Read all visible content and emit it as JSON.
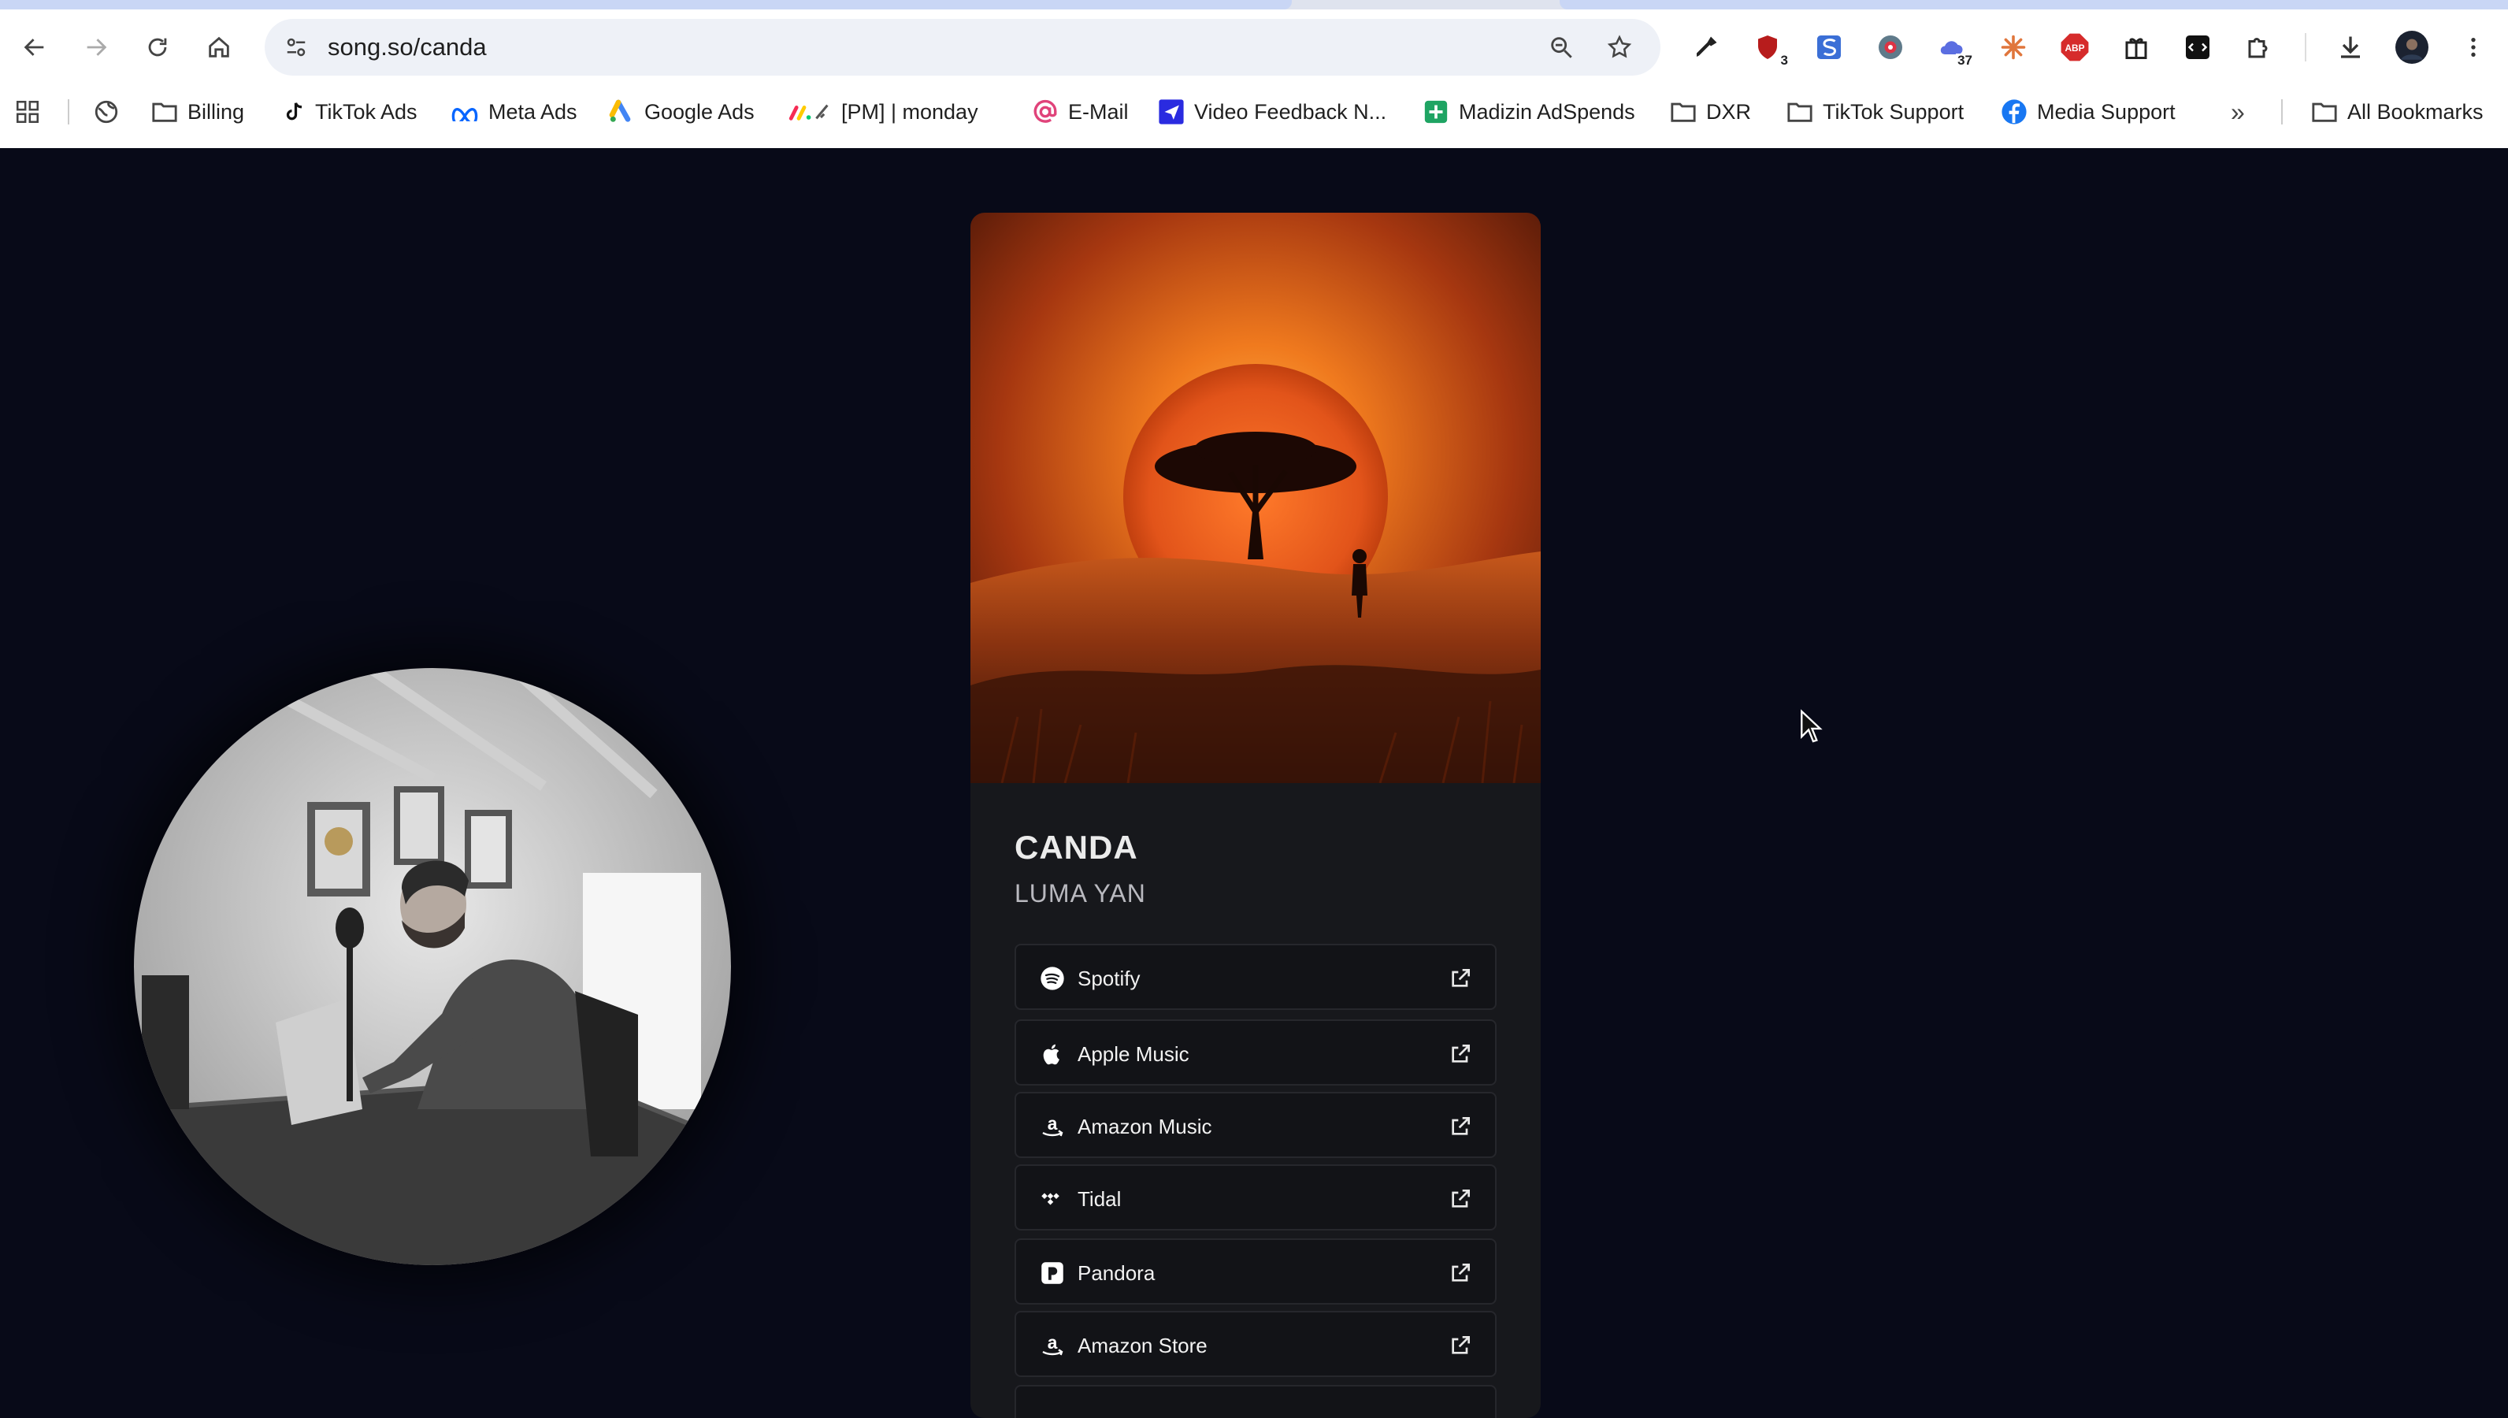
{
  "browser": {
    "url": "song.so/canda",
    "extensions": [
      {
        "name": "eyedropper-extension-icon",
        "badge": ""
      },
      {
        "name": "shield-extension-icon",
        "badge": "3"
      },
      {
        "name": "s-extension-icon",
        "badge": ""
      },
      {
        "name": "globe-extension-icon",
        "badge": ""
      },
      {
        "name": "cloud-extension-icon",
        "badge": "37"
      },
      {
        "name": "starburst-extension-icon",
        "badge": ""
      },
      {
        "name": "abp-extension-icon",
        "badge": "",
        "text": "ABP"
      },
      {
        "name": "gift-extension-icon",
        "badge": ""
      },
      {
        "name": "code-extension-icon",
        "badge": ""
      },
      {
        "name": "puzzle-extensions-icon",
        "badge": ""
      }
    ],
    "bookmarks": [
      {
        "label": "Billing",
        "icon": "folder-icon"
      },
      {
        "label": "TikTok Ads",
        "icon": "tiktok-icon"
      },
      {
        "label": "Meta Ads",
        "icon": "meta-icon"
      },
      {
        "label": "Google Ads",
        "icon": "google-ads-icon"
      },
      {
        "label": "[PM] | monday",
        "icon": "monday-icon"
      },
      {
        "label": "E-Mail",
        "icon": "at-icon"
      },
      {
        "label": "Video Feedback N...",
        "icon": "video-feedback-icon"
      },
      {
        "label": "Madizin AdSpends",
        "icon": "sheets-icon"
      },
      {
        "label": "DXR",
        "icon": "folder-icon"
      },
      {
        "label": "TikTok Support",
        "icon": "folder-icon"
      },
      {
        "label": "Media Support",
        "icon": "facebook-icon"
      },
      {
        "label": "All Bookmarks",
        "icon": "folder-icon"
      }
    ],
    "overflow_label": "»"
  },
  "song": {
    "title": "CANDA",
    "artist": "LUMA YAN",
    "links": [
      {
        "label": "Spotify",
        "icon": "spotify-icon"
      },
      {
        "label": "Apple Music",
        "icon": "apple-icon"
      },
      {
        "label": "Amazon Music",
        "icon": "amazon-icon"
      },
      {
        "label": "Tidal",
        "icon": "tidal-icon"
      },
      {
        "label": "Pandora",
        "icon": "pandora-icon"
      },
      {
        "label": "Amazon Store",
        "icon": "amazon-icon"
      }
    ]
  },
  "colors": {
    "page_bg": "#080a18",
    "card_bg": "#17181c",
    "link_bg": "#121317",
    "sun": "#e2541a"
  }
}
